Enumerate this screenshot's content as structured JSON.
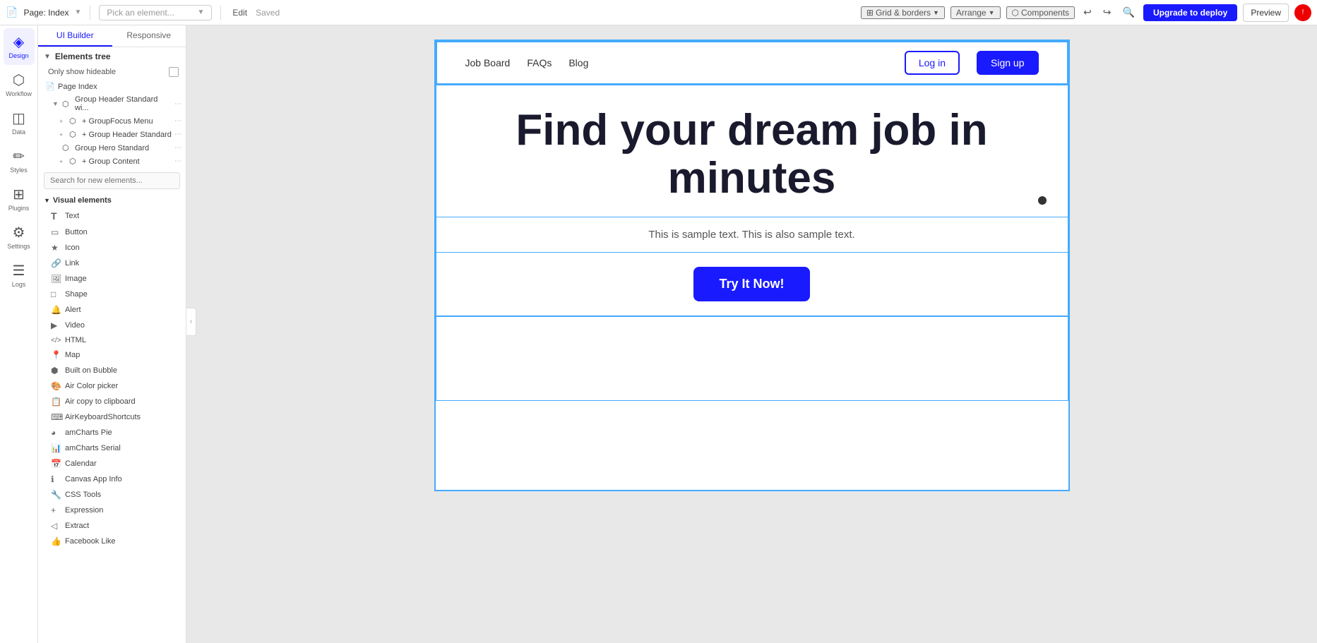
{
  "topbar": {
    "page_label": "Page: Index",
    "pick_element_placeholder": "Pick an element...",
    "edit_label": "Edit",
    "saved_label": "Saved",
    "grid_borders_label": "Grid & borders",
    "arrange_label": "Arrange",
    "components_label": "Components",
    "upgrade_label": "Upgrade to deploy",
    "preview_label": "Preview"
  },
  "left_sidebar": {
    "items": [
      {
        "id": "design",
        "label": "Design",
        "icon": "◈",
        "active": true
      },
      {
        "id": "workflow",
        "label": "Workflow",
        "icon": "⬡",
        "active": false
      },
      {
        "id": "data",
        "label": "Data",
        "icon": "◫",
        "active": false
      },
      {
        "id": "styles",
        "label": "Styles",
        "icon": "✏",
        "active": false
      },
      {
        "id": "plugins",
        "label": "Plugins",
        "icon": "⊞",
        "active": false
      },
      {
        "id": "settings",
        "label": "Settings",
        "icon": "⚙",
        "active": false
      },
      {
        "id": "logs",
        "label": "Logs",
        "icon": "☰",
        "active": false
      }
    ]
  },
  "panel": {
    "tabs": [
      {
        "id": "ui-builder",
        "label": "UI Builder",
        "active": true
      },
      {
        "id": "responsive",
        "label": "Responsive",
        "active": false
      }
    ],
    "elements_tree": {
      "section_title": "Elements tree",
      "only_hideable_label": "Only show hideable",
      "tree_items": [
        {
          "label": "Page Index",
          "indent": 0,
          "expandable": false
        },
        {
          "label": "Group Header Standard wi...",
          "indent": 0,
          "expandable": true
        },
        {
          "label": "+ GroupFocus Menu",
          "indent": 1,
          "expandable": false
        },
        {
          "label": "+ Group Header Standard",
          "indent": 1,
          "expandable": false
        },
        {
          "label": "Group Hero Standard",
          "indent": 0,
          "expandable": false
        },
        {
          "label": "+ Group Content",
          "indent": 1,
          "expandable": false
        }
      ],
      "search_placeholder": "Search for new elements..."
    },
    "visual_elements": {
      "section_title": "Visual elements",
      "items": [
        {
          "id": "text",
          "label": "Text",
          "icon": "T"
        },
        {
          "id": "button",
          "label": "Button",
          "icon": "▭"
        },
        {
          "id": "icon",
          "label": "Icon",
          "icon": "★"
        },
        {
          "id": "link",
          "label": "Link",
          "icon": "🔗"
        },
        {
          "id": "image",
          "label": "Image",
          "icon": "🖼"
        },
        {
          "id": "shape",
          "label": "Shape",
          "icon": "□"
        },
        {
          "id": "alert",
          "label": "Alert",
          "icon": "🔔"
        },
        {
          "id": "video",
          "label": "Video",
          "icon": "▶"
        },
        {
          "id": "html",
          "label": "HTML",
          "icon": "</>"
        },
        {
          "id": "map",
          "label": "Map",
          "icon": "📍"
        },
        {
          "id": "built-on-bubble",
          "label": "Built on Bubble",
          "icon": "⬢"
        },
        {
          "id": "air-color-picker",
          "label": "Air Color picker",
          "icon": "🎨"
        },
        {
          "id": "air-copy-clipboard",
          "label": "Air copy to clipboard",
          "icon": "📋"
        },
        {
          "id": "air-keyboard-shortcuts",
          "label": "AirKeyboardShortcuts",
          "icon": "⌨"
        },
        {
          "id": "amcharts-pie",
          "label": "amCharts Pie",
          "icon": "◕"
        },
        {
          "id": "amcharts-serial",
          "label": "amCharts Serial",
          "icon": "📊"
        },
        {
          "id": "calendar",
          "label": "Calendar",
          "icon": "📅"
        },
        {
          "id": "canvas-app-info",
          "label": "Canvas App Info",
          "icon": "ℹ"
        },
        {
          "id": "css-tools",
          "label": "CSS Tools",
          "icon": "🔧"
        },
        {
          "id": "expression",
          "label": "Expression",
          "icon": "+"
        },
        {
          "id": "extract",
          "label": "Extract",
          "icon": "◁"
        },
        {
          "id": "facebook-like",
          "label": "Facebook Like",
          "icon": "👍"
        }
      ]
    }
  },
  "canvas": {
    "navbar": {
      "links": [
        {
          "label": "Job Board"
        },
        {
          "label": "FAQs"
        },
        {
          "label": "Blog"
        }
      ],
      "login_label": "Log in",
      "signup_label": "Sign up"
    },
    "hero": {
      "title": "Find your dream job in minutes",
      "subtitle": "This is sample text. This is also sample text.",
      "cta_label": "Try It Now!"
    }
  }
}
